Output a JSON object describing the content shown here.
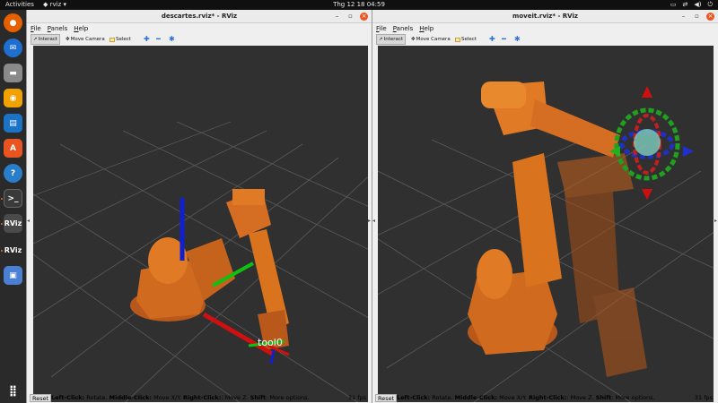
{
  "topbar": {
    "activities": "Activities",
    "app_menu": "rviz",
    "clock": "Thg 12 18  04:59"
  },
  "dock": {
    "items": [
      {
        "name": "firefox-icon",
        "color": "#e66000"
      },
      {
        "name": "thunderbird-icon",
        "color": "#1f6fd1"
      },
      {
        "name": "files-icon",
        "color": "#8a8a8a"
      },
      {
        "name": "rhythmbox-icon",
        "color": "#f2a200"
      },
      {
        "name": "writer-icon",
        "color": "#1a73c7"
      },
      {
        "name": "app-store-icon",
        "color": "#e95420"
      },
      {
        "name": "help-icon",
        "color": "#2a7ec9"
      },
      {
        "name": "terminal-icon",
        "color": "#3a3a3a"
      },
      {
        "name": "rviz-icon",
        "label": "RViz",
        "color": "#333"
      },
      {
        "name": "rviz-icon",
        "label": "RViz",
        "color": "#333"
      },
      {
        "name": "screenshot-icon",
        "color": "#4a7fd4"
      }
    ],
    "apps_grid": "show-apps-icon"
  },
  "windows": [
    {
      "title": "descartes.rviz* - RViz",
      "menu": [
        "File",
        "Panels",
        "Help"
      ],
      "tools": [
        "Interact",
        "Move Camera",
        "Select"
      ],
      "status": {
        "reset": "Reset",
        "left_click": "Left-Click:",
        "left_click_desc": " Rotate. ",
        "middle_click": "Middle-Click:",
        "middle_click_desc": " Move X/Y. ",
        "right_click": "Right-Click:",
        "right_click_desc": ": Move Z. ",
        "shift": "Shift",
        "shift_desc": ": More options.",
        "fps": "31 fps"
      },
      "frame_label": "tool0"
    },
    {
      "title": "moveit.rviz* - RViz",
      "menu": [
        "File",
        "Panels",
        "Help"
      ],
      "tools": [
        "Interact",
        "Move Camera",
        "Select"
      ],
      "status": {
        "reset": "Reset",
        "left_click": "Left-Click:",
        "left_click_desc": " Rotate. ",
        "middle_click": "Middle-Click:",
        "middle_click_desc": " Move X/Y. ",
        "right_click": "Right-Click:",
        "right_click_desc": ": Move Z. ",
        "shift": "Shift",
        "shift_desc": ": More options.",
        "fps": "31 fps"
      }
    }
  ],
  "colors": {
    "robot": "#d9731e",
    "viewport_bg": "#303030",
    "grid": "#585858",
    "accent": "#e95420"
  }
}
